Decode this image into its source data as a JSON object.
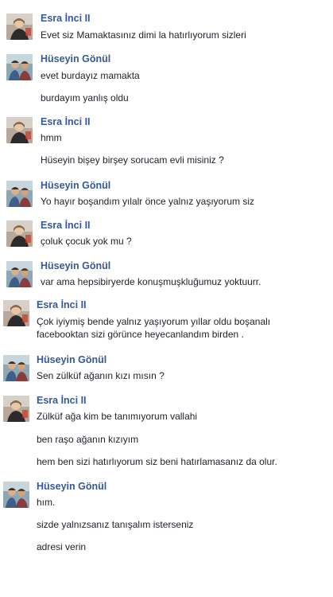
{
  "colors": {
    "sender_name": "#365899",
    "message_text": "#1d2129",
    "background": "#ffffff"
  },
  "messages": [
    {
      "sender": "Esra İnci II",
      "avatar": "avatar-esra",
      "lines": [
        "Evet siz Mamaktasınız dimi la hatırlıyorum sizleri"
      ]
    },
    {
      "sender": "Hüseyin Gönül",
      "avatar": "avatar-huseyin",
      "lines": [
        "evet burdayız mamakta",
        "burdayım yanlış oldu"
      ]
    },
    {
      "sender": "Esra İnci II",
      "avatar": "avatar-esra",
      "lines": [
        "hmm",
        "Hüseyin bişey birşey sorucam evli misiniz ?"
      ]
    },
    {
      "sender": "Hüseyin Gönül",
      "avatar": "avatar-huseyin",
      "lines": [
        "Yo hayır boşandım yılalr önce yalnız yaşıyorum siz"
      ]
    },
    {
      "sender": "Esra İnci II",
      "avatar": "avatar-esra",
      "lines": [
        "çoluk çocuk yok mu ?"
      ]
    },
    {
      "sender": "Hüseyin Gönül",
      "avatar": "avatar-huseyin",
      "lines": [
        "var ama hepsibiryerde konuşmuşkluğumuz yoktuurr."
      ]
    },
    {
      "sender": "Esra İnci II",
      "avatar": "avatar-esra",
      "lines": [
        "Çok iyiymiş bende yalnız yaşıyorum yıllar oldu boşanalı facebooktan sizi görünce heyecanlandım birden ."
      ]
    },
    {
      "sender": "Hüseyin Gönül",
      "avatar": "avatar-huseyin",
      "lines": [
        "Sen zülküf ağanın kızı mısın ?"
      ]
    },
    {
      "sender": "Esra İnci II",
      "avatar": "avatar-esra",
      "lines": [
        "Zülküf ağa kim be tanımıyorum vallahi",
        "ben raşo ağanın kızıyım",
        "hem ben sizi hatırlıyorum siz beni hatırlamasanız da olur."
      ]
    },
    {
      "sender": "Hüseyin Gönül",
      "avatar": "avatar-huseyin",
      "lines": [
        "hım.",
        "sizde yalnızsanız tanışalım isterseniz",
        "adresi verin"
      ]
    }
  ]
}
